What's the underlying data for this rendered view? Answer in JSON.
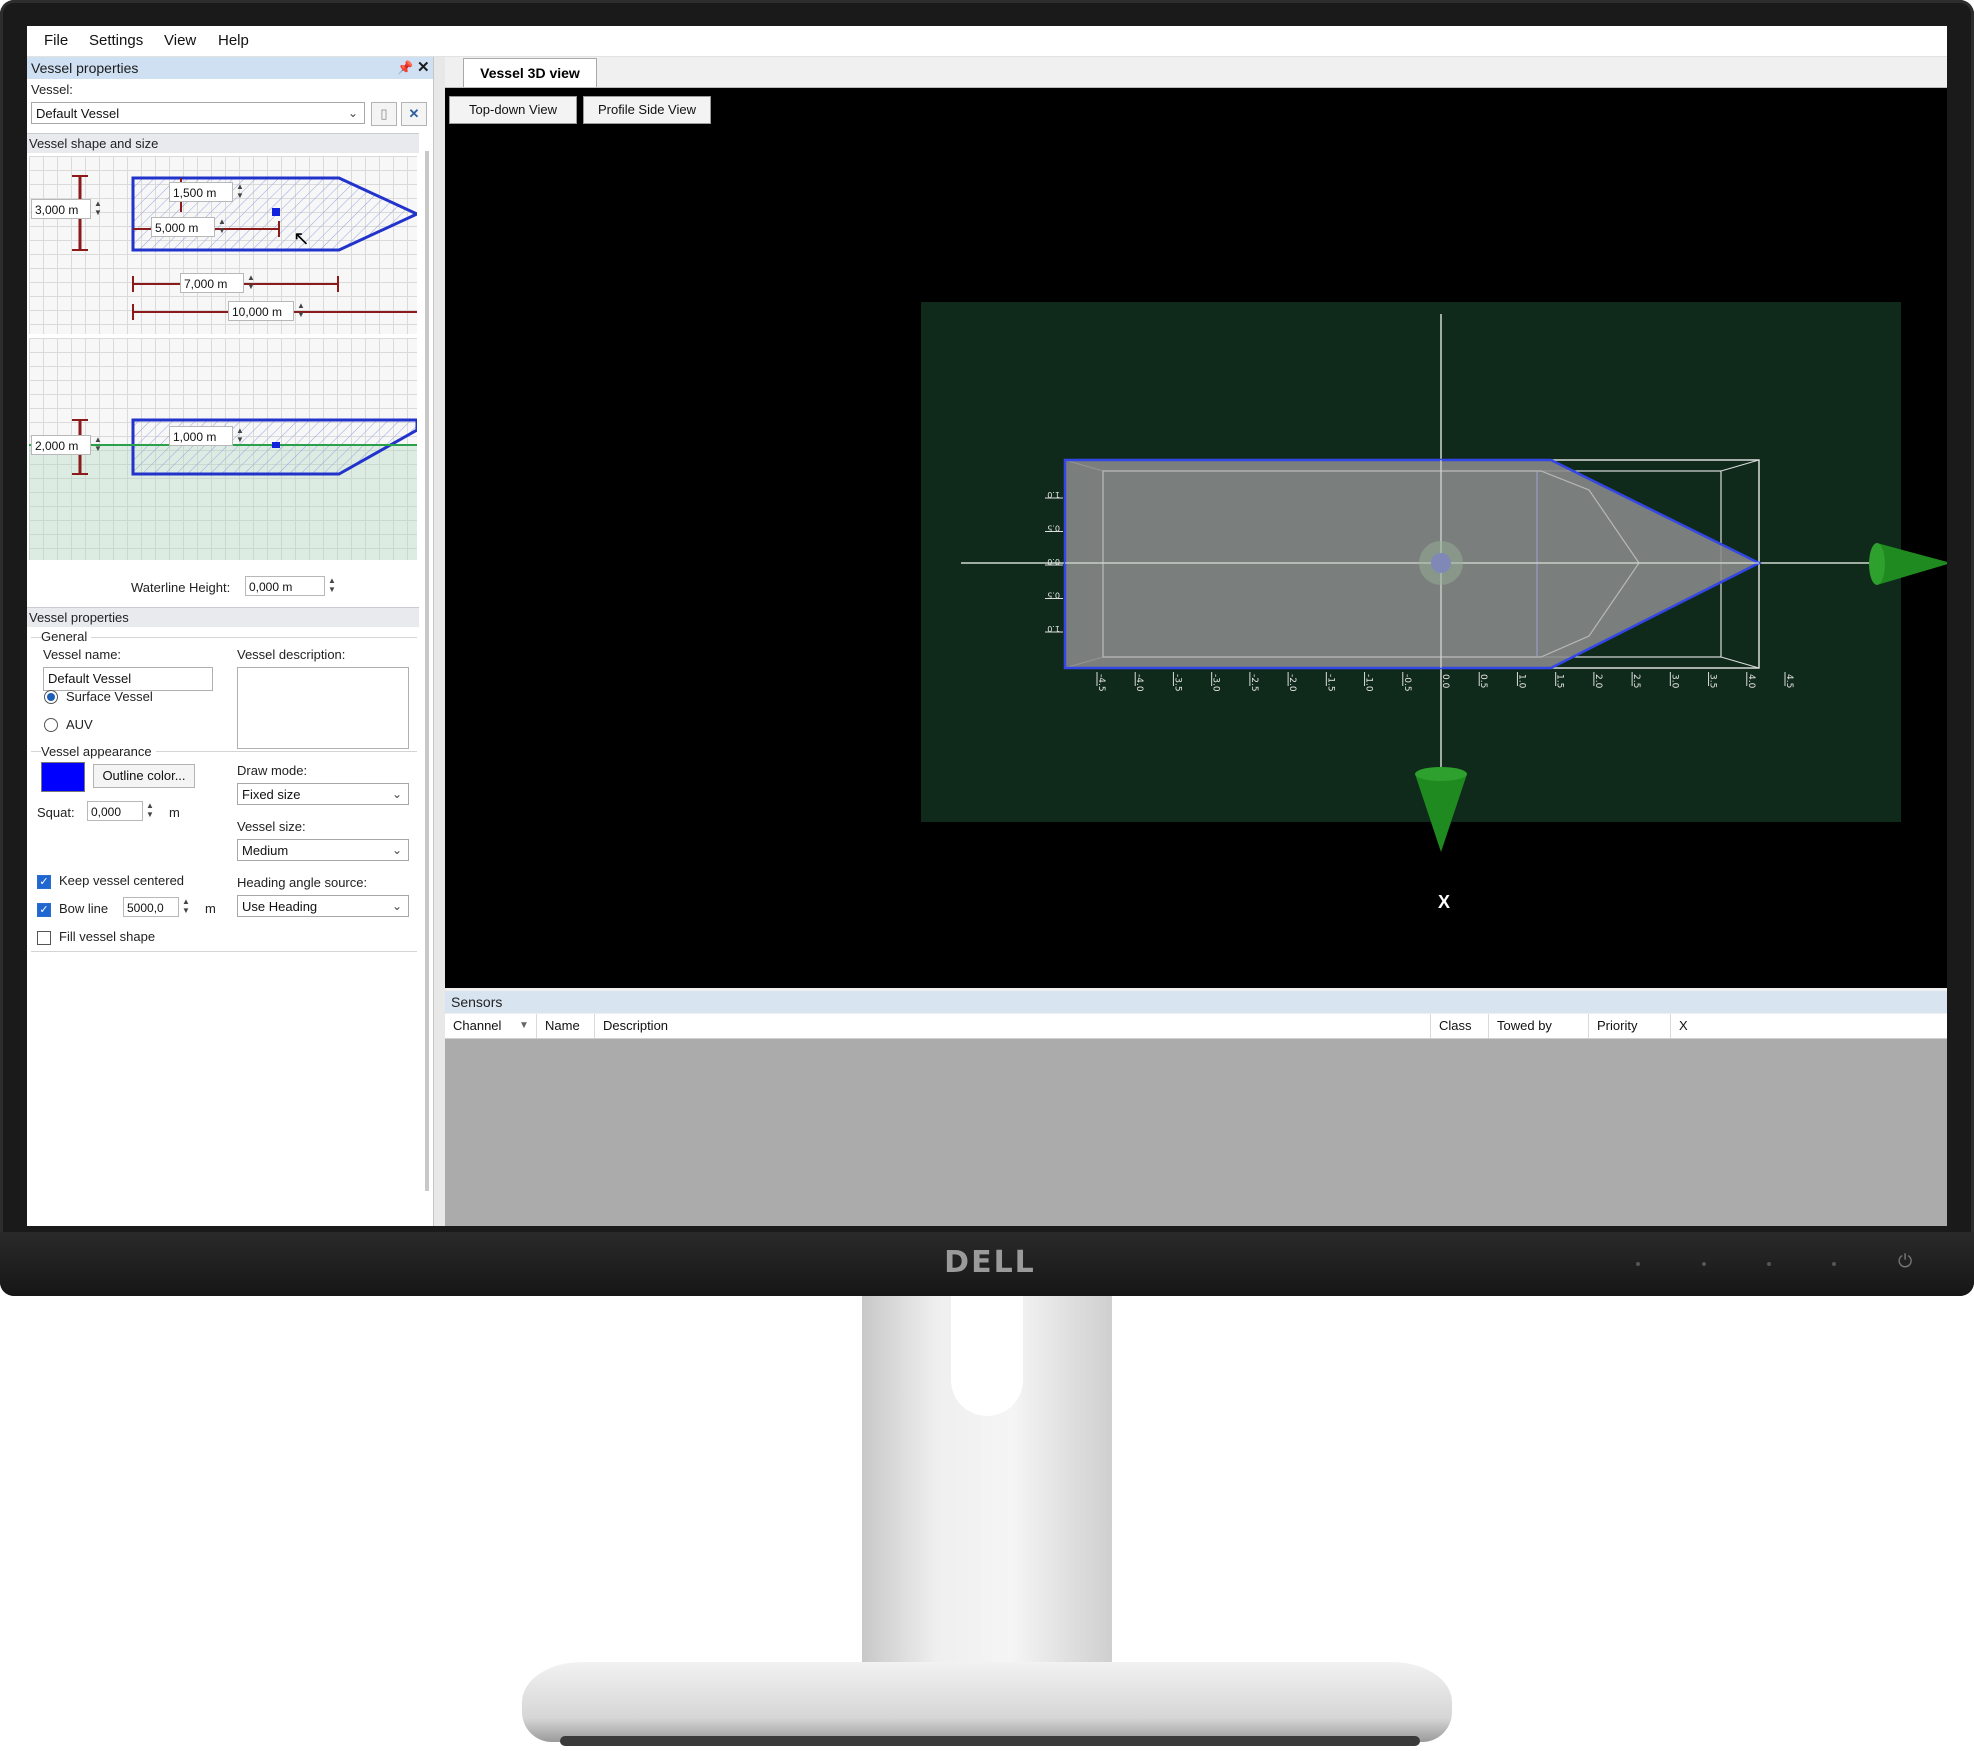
{
  "monitor": {
    "brand": "DELL",
    "power_icon": "power-icon"
  },
  "menu": [
    "File",
    "Settings",
    "View",
    "Help"
  ],
  "left_panel": {
    "title": "Vessel properties",
    "vessel_label": "Vessel:",
    "vessel_select": "Default Vessel",
    "shape_section": "Vessel shape and size",
    "top_view": {
      "width": "3,000 m",
      "bow_offset": "1,500 m",
      "center_offset": "5,000 m",
      "hull_length": "7,000 m",
      "total_length": "10,000 m"
    },
    "side_view": {
      "height": "2,000 m",
      "draft": "1,000 m"
    },
    "waterline_label": "Waterline Height:",
    "waterline_value": "0,000 m",
    "props_section": "Vessel properties",
    "general_label": "General",
    "name_label": "Vessel name:",
    "name_value": "Default Vessel",
    "description_label": "Vessel description:",
    "description_value": "",
    "type_options": [
      {
        "label": "Surface Vessel",
        "selected": true
      },
      {
        "label": "AUV",
        "selected": false
      }
    ],
    "appearance_label": "Vessel appearance",
    "outline_color": "#0000ff",
    "outline_button": "Outline color...",
    "squat_label": "Squat:",
    "squat_value": "0,000",
    "squat_unit": "m",
    "draw_mode_label": "Draw mode:",
    "draw_mode_value": "Fixed size",
    "vessel_size_label": "Vessel size:",
    "vessel_size_value": "Medium",
    "heading_label": "Heading angle source:",
    "heading_value": "Use Heading",
    "keep_centered": {
      "label": "Keep vessel centered",
      "checked": true
    },
    "bow_line": {
      "label": "Bow line",
      "checked": true,
      "value": "5000,0",
      "unit": "m"
    },
    "fill_shape": {
      "label": "Fill vessel shape",
      "checked": false
    }
  },
  "view3d": {
    "tab": "Vessel 3D view",
    "buttons": [
      "Top-down View",
      "Profile Side View"
    ],
    "axis_label": "X",
    "x_ticks": [
      "-4.5",
      "-4.0",
      "-3.5",
      "-3.0",
      "-2.5",
      "-2.0",
      "-1.5",
      "-1.0",
      "-0.5",
      "0.0",
      "0.5",
      "1.0",
      "1.5",
      "2.0",
      "2.5",
      "3.0",
      "3.5",
      "4.0",
      "4.5"
    ],
    "y_ticks": [
      "1.0",
      "0.5",
      "0.0",
      "0.5",
      "1.0"
    ],
    "colors": {
      "plane": "#0f2a1b",
      "hull": "#8a8a8a",
      "outline": "#3346e6",
      "arrow": "#1f8a1f"
    }
  },
  "sensors": {
    "title": "Sensors",
    "columns": [
      "Channel",
      "Name",
      "Description",
      "Class",
      "Towed by",
      "Priority",
      "X"
    ]
  }
}
